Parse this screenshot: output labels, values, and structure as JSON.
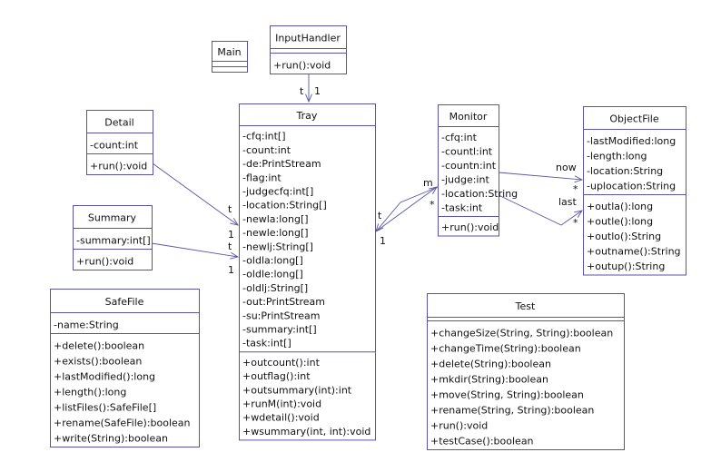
{
  "diagram_type": "UML class diagram",
  "colors": {
    "stroke": "#5a54a8",
    "text": "#111111",
    "background": "#ffffff"
  },
  "classes": [
    {
      "id": "Main",
      "name": "Main",
      "attributes": [],
      "methods": []
    },
    {
      "id": "InputHandler",
      "name": "InputHandler",
      "attributes": [],
      "methods": [
        "+run():void"
      ]
    },
    {
      "id": "Tray",
      "name": "Tray",
      "attributes": [
        "-cfq:int[]",
        "-count:int",
        "-de:PrintStream",
        "-flag:int",
        "-judgecfq:int[]",
        "-location:String[]",
        "-newla:long[]",
        "-newle:long[]",
        "-newlj:String[]",
        "-oldla:long[]",
        "-oldle:long[]",
        "-oldlj:String[]",
        "-out:PrintStream",
        "-su:PrintStream",
        "-summary:int[]",
        "-task:int[]"
      ],
      "methods": [
        "+outcount():int",
        "+outflag():int",
        "+outsummary(int):int",
        "+runM(int):void",
        "+wdetail():void",
        "+wsummary(int, int):void"
      ]
    },
    {
      "id": "Monitor",
      "name": "Monitor",
      "attributes": [
        "-cfq:int",
        "-countl:int",
        "-countn:int",
        "-judge:int",
        "-location:String",
        "-task:int"
      ],
      "methods": [
        "+run():void"
      ]
    },
    {
      "id": "ObjectFile",
      "name": "ObjectFile",
      "attributes": [
        "-lastModified:long",
        "-length:long",
        "-location:String",
        "-uplocation:String"
      ],
      "methods": [
        "+outla():long",
        "+outle():long",
        "+outlo():String",
        "+outname():String",
        "+outup():String"
      ]
    },
    {
      "id": "Detail",
      "name": "Detail",
      "attributes": [
        "-count:int"
      ],
      "methods": [
        "+run():void"
      ]
    },
    {
      "id": "Summary",
      "name": "Summary",
      "attributes": [
        "-summary:int[]"
      ],
      "methods": [
        "+run():void"
      ]
    },
    {
      "id": "SafeFile",
      "name": "SafeFile",
      "attributes": [
        "-name:String"
      ],
      "methods": [
        "+delete():boolean",
        "+exists():boolean",
        "+lastModified():long",
        "+length():long",
        "+listFiles():SafeFile[]",
        "+rename(SafeFile):boolean",
        "+write(String):boolean"
      ]
    },
    {
      "id": "Test",
      "name": "Test",
      "attributes": [],
      "methods": [
        "+changeSize(String, String):boolean",
        "+changeTime(String):boolean",
        "+delete(String):boolean",
        "+mkdir(String):boolean",
        "+move(String, String):boolean",
        "+rename(String, String):boolean",
        "+run():void",
        "+testCase():boolean"
      ]
    }
  ],
  "associations": [
    {
      "from": "InputHandler",
      "to": "Tray",
      "labels": [
        "t",
        "1"
      ]
    },
    {
      "from": "Detail",
      "to": "Tray",
      "labels": [
        "t",
        "1"
      ]
    },
    {
      "from": "Summary",
      "to": "Tray",
      "labels": [
        "t",
        "1"
      ]
    },
    {
      "from": "Monitor",
      "to": "Tray",
      "labels": [
        "t",
        "1"
      ]
    },
    {
      "from": "Tray",
      "to": "Monitor",
      "labels": [
        "m",
        "*"
      ]
    },
    {
      "from": "Monitor",
      "to": "ObjectFile",
      "labels": [
        "now",
        "*"
      ]
    },
    {
      "from": "Monitor",
      "to": "ObjectFile",
      "labels": [
        "last",
        "*"
      ]
    }
  ]
}
